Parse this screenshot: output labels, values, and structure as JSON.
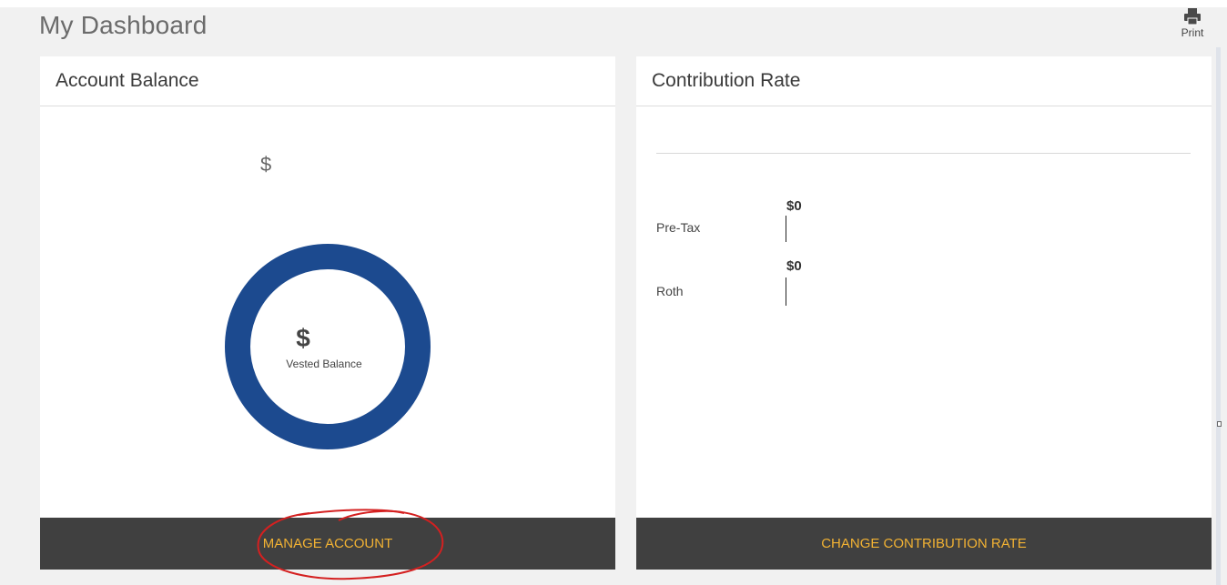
{
  "page": {
    "title": "My Dashboard",
    "print_label": "Print"
  },
  "account_balance": {
    "title": "Account Balance",
    "top_value": "$",
    "donut_value": "$",
    "donut_label": "Vested Balance",
    "donut_color": "#1c4a8f",
    "button_label": "MANAGE ACCOUNT"
  },
  "contribution_rate": {
    "title": "Contribution Rate",
    "rows": [
      {
        "label": "Pre-Tax",
        "value": "$0"
      },
      {
        "label": "Roth",
        "value": "$0"
      }
    ],
    "button_label": "CHANGE CONTRIBUTION RATE"
  },
  "colors": {
    "footer_bg": "#404040",
    "footer_text": "#f2b233",
    "annotation": "#d42020"
  },
  "icons": {
    "print": "printer-icon"
  }
}
